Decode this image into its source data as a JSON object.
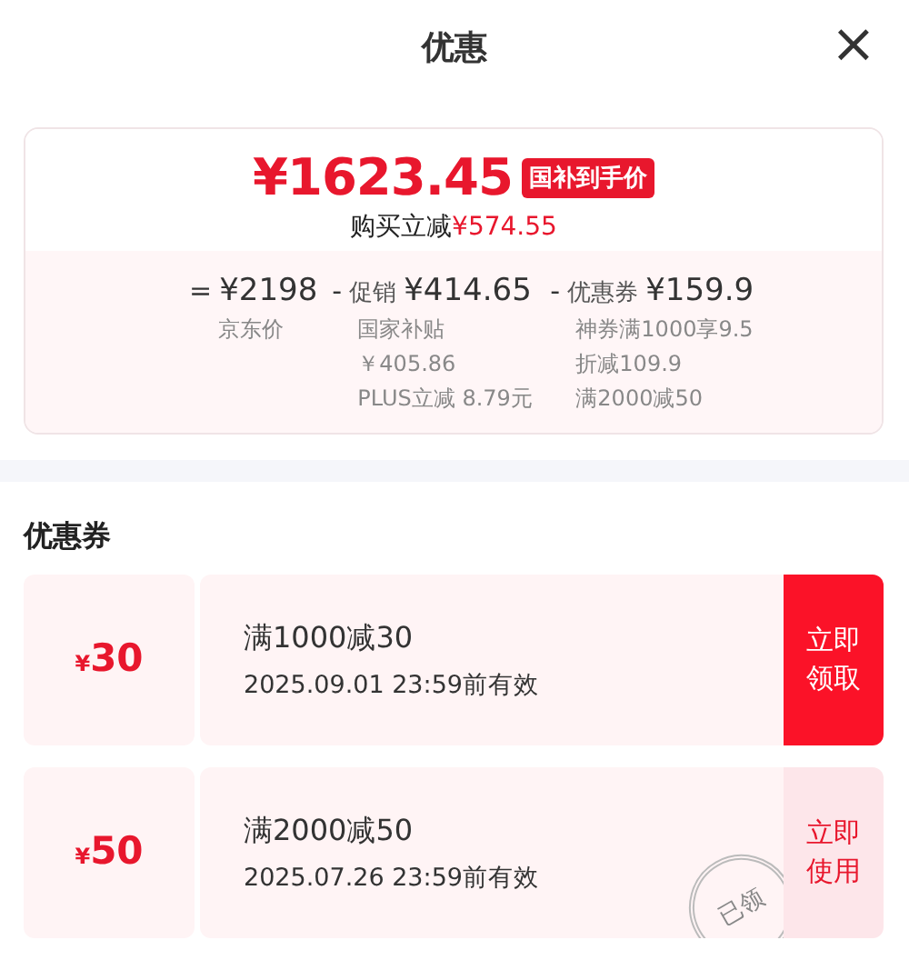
{
  "header": {
    "title": "优惠",
    "close": "×"
  },
  "price": {
    "amount": "¥1623.45",
    "badge": "国补到手价",
    "saving_label": "购买立减",
    "saving_amount": "¥574.55"
  },
  "breakdown": [
    {
      "op": "=",
      "amount": "¥2198",
      "notes": [
        "京东价"
      ]
    },
    {
      "op": "-",
      "label": "促销",
      "amount": "¥414.65",
      "notes": [
        "国家补贴",
        "￥405.86",
        "PLUS立减 8.79元"
      ]
    },
    {
      "op": "-",
      "label": "优惠券",
      "amount": "¥159.9",
      "notes": [
        "神券满1000享9.5",
        "折减109.9",
        "满2000减50"
      ]
    }
  ],
  "coupons_title": "优惠券",
  "coupons": [
    {
      "currency": "¥",
      "value": "30",
      "condition": "满1000减30",
      "validity": "2025.09.01 23:59前有效",
      "action": "立即领取",
      "claimed": false
    },
    {
      "currency": "¥",
      "value": "50",
      "condition": "满2000减50",
      "validity": "2025.07.26 23:59前有效",
      "action": "立即使用",
      "claimed": true,
      "stamp": "已领"
    }
  ]
}
